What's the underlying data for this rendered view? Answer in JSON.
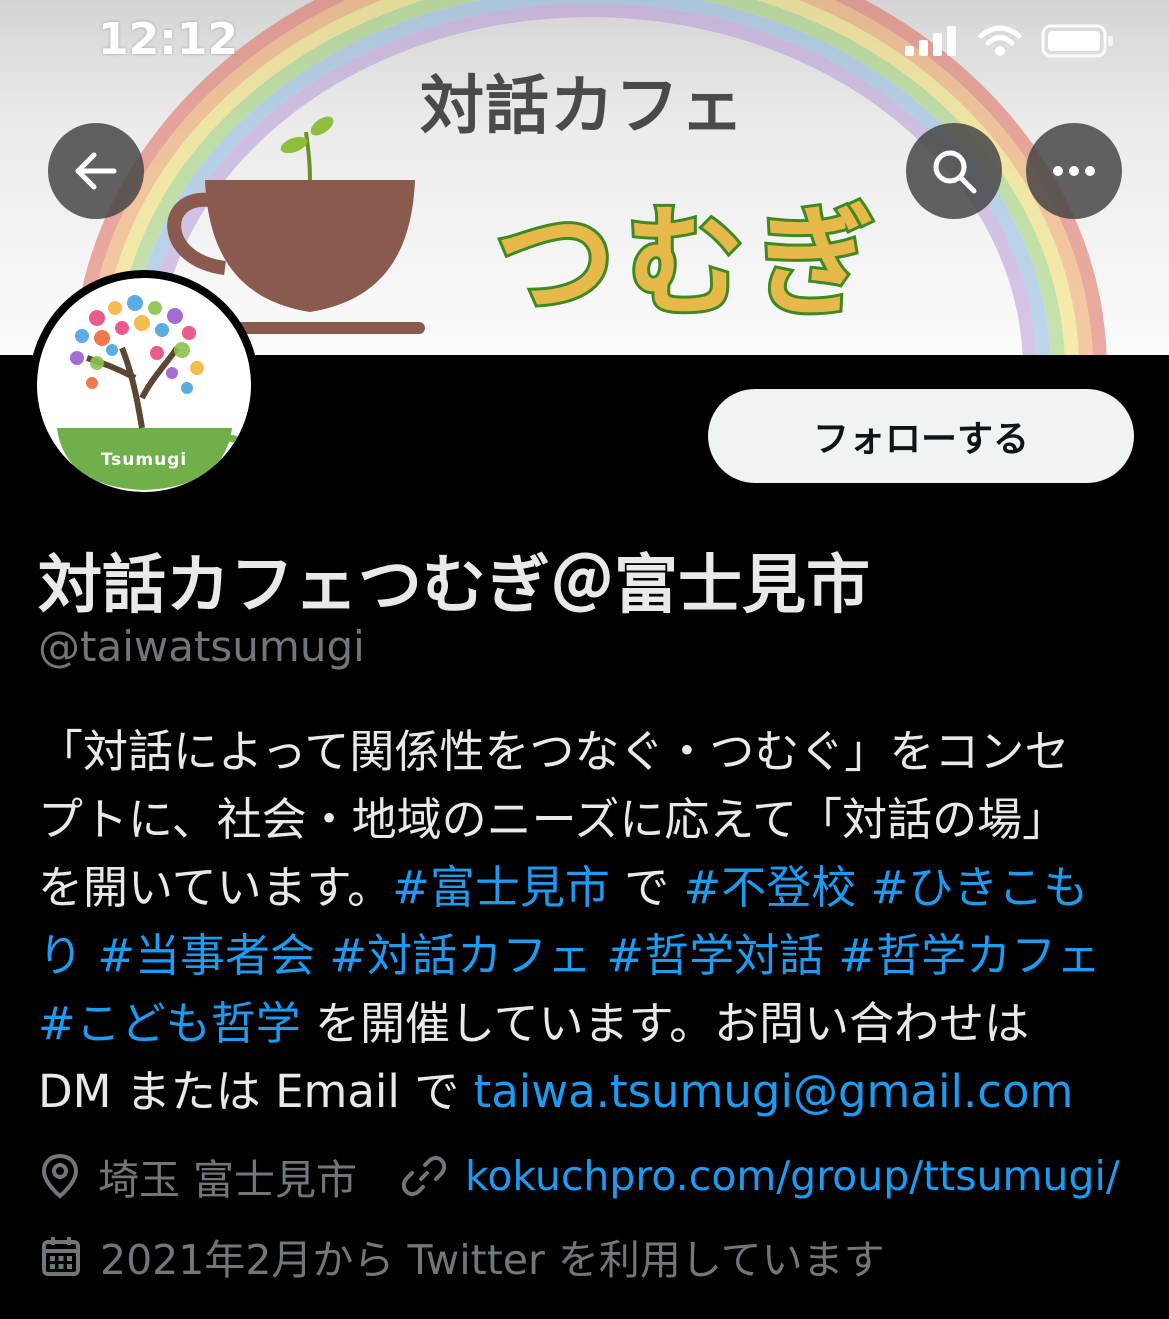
{
  "status_bar": {
    "time": "12:12"
  },
  "banner": {
    "title": "対話カフェ",
    "subtitle": "つむぎ"
  },
  "avatar": {
    "label": "Tsumugi"
  },
  "actions": {
    "follow_label": "フォローする"
  },
  "profile": {
    "display_name": "対話カフェつむぎ＠富士見市",
    "handle": "@taiwatsumugi",
    "bio": {
      "l1": "「対話によって関係性をつなぐ・つむぐ」をコンセ",
      "l2": "プトに、社会・地域のニーズに応えて「対話の場」",
      "l3_a": "を開いています。",
      "tag_fujimi": "#富士見市",
      "l3_b": " で ",
      "tag_futoko": "#不登校",
      "l3_c": " ",
      "tag_hikikomori_a": "#ひきこも",
      "tag_hikikomori_b": "り",
      "l4_a": " ",
      "tag_tojisha": "#当事者会",
      "l4_b": " ",
      "tag_cafe": "#対話カフェ",
      "l4_c": " ",
      "tag_tetsugaku_taiwa": "#哲学対話",
      "l4_d": " ",
      "tag_tetsugaku_cafe": "#哲学カフェ",
      "tag_kodomo": "#こども哲学",
      "l5_b": " を開催しています。お問い合わせは",
      "l6_a": "DM または Email で ",
      "email": "taiwa.tsumugi@gmail.com"
    },
    "location": "埼玉 富士見市",
    "website": "kokuchpro.com/group/ttsumugi/",
    "joined": "2021年2月から Twitter を利用しています"
  },
  "icons": {
    "back": "arrow-left-icon",
    "search": "search-icon",
    "more": "more-horizontal-icon",
    "location": "location-pin-icon",
    "link": "link-icon",
    "calendar": "calendar-icon"
  },
  "colors": {
    "background": "#000000",
    "accent_link": "#1d9bf0",
    "muted_text": "#71767b",
    "primary_text": "#e7e9ea",
    "follow_button_bg": "#eff3f4"
  }
}
